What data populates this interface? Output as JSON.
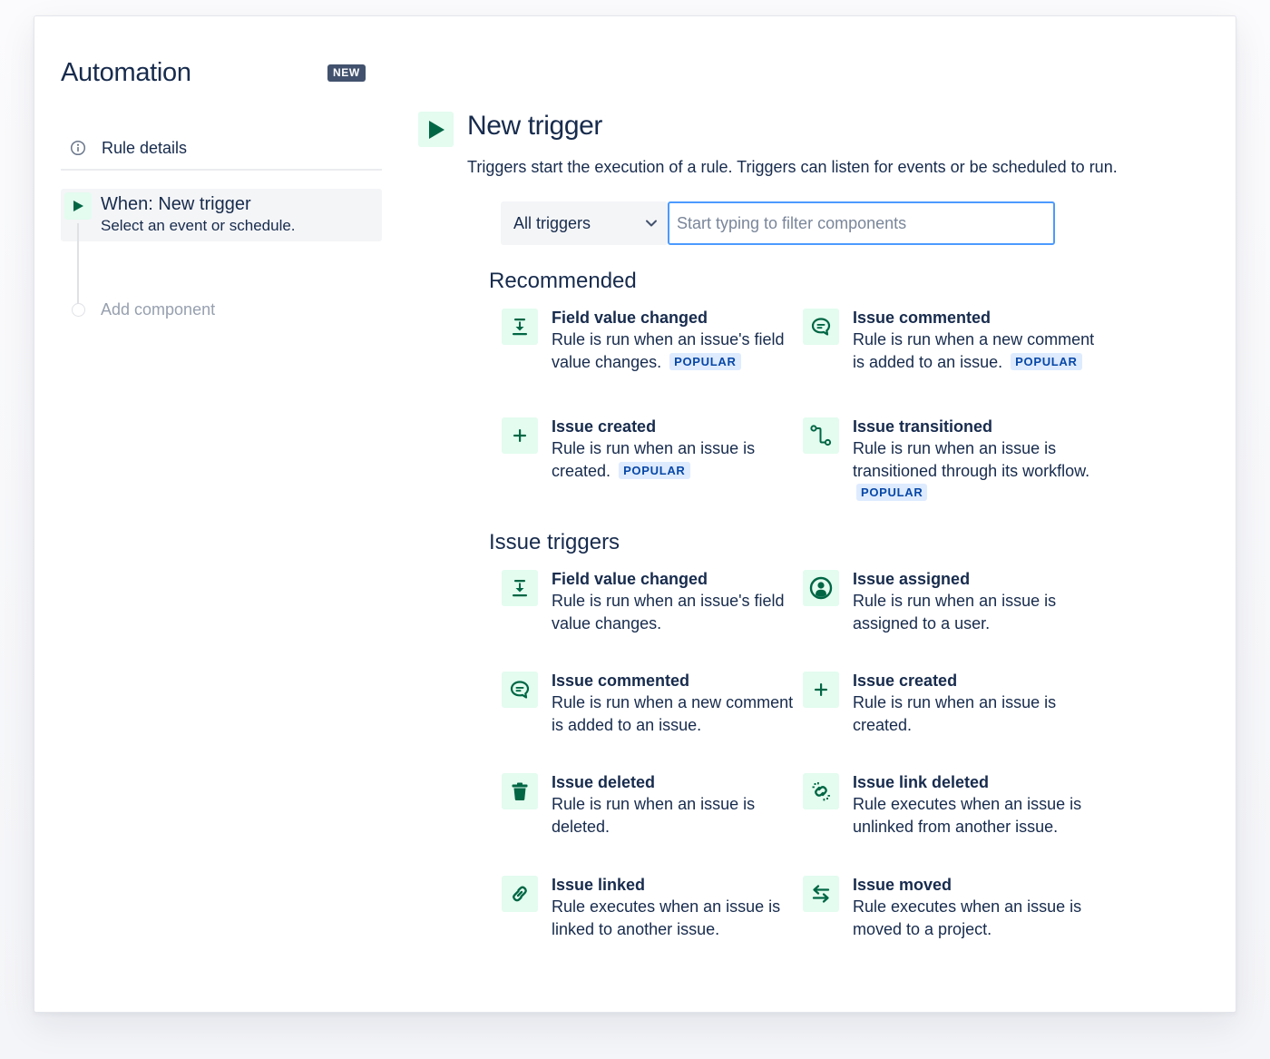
{
  "sidebar": {
    "app_title": "Automation",
    "new_badge": "NEW",
    "rule_details_label": "Rule details",
    "trigger_step": {
      "title": "When: New trigger",
      "subtitle": "Select an event or schedule."
    },
    "add_component_label": "Add component"
  },
  "main": {
    "title": "New trigger",
    "description": "Triggers start the execution of a rule. Triggers can listen for events or be scheduled to run.",
    "filter": {
      "select_value": "All triggers",
      "input_value": "",
      "input_placeholder": "Start typing to filter components"
    },
    "popular_label": "POPULAR",
    "sections": [
      {
        "title": "Recommended",
        "items": [
          {
            "name": "Field value changed",
            "description": "Rule is run when an issue's field value changes.",
            "icon": "field-value-changed-icon",
            "popular": true
          },
          {
            "name": "Issue commented",
            "description": "Rule is run when a new comment is added to an issue.",
            "icon": "comment-icon",
            "popular": true
          },
          {
            "name": "Issue created",
            "description": "Rule is run when an issue is created.",
            "icon": "plus-icon",
            "popular": true
          },
          {
            "name": "Issue transitioned",
            "description": "Rule is run when an issue is transitioned through its workflow.",
            "icon": "transition-icon",
            "popular": true
          }
        ]
      },
      {
        "title": "Issue triggers",
        "items": [
          {
            "name": "Field value changed",
            "description": "Rule is run when an issue's field value changes.",
            "icon": "field-value-changed-icon",
            "popular": false
          },
          {
            "name": "Issue assigned",
            "description": "Rule is run when an issue is assigned to a user.",
            "icon": "user-avatar-icon",
            "popular": false
          },
          {
            "name": "Issue commented",
            "description": "Rule is run when a new comment is added to an issue.",
            "icon": "comment-icon",
            "popular": false
          },
          {
            "name": "Issue created",
            "description": "Rule is run when an issue is created.",
            "icon": "plus-icon",
            "popular": false
          },
          {
            "name": "Issue deleted",
            "description": "Rule is run when an issue is deleted.",
            "icon": "trash-icon",
            "popular": false
          },
          {
            "name": "Issue link deleted",
            "description": "Rule executes when an issue is unlinked from another issue.",
            "icon": "unlink-icon",
            "popular": false
          },
          {
            "name": "Issue linked",
            "description": "Rule executes when an issue is linked to another issue.",
            "icon": "link-icon",
            "popular": false
          },
          {
            "name": "Issue moved",
            "description": "Rule executes when an issue is moved to a project.",
            "icon": "move-arrows-icon",
            "popular": false
          }
        ]
      }
    ]
  },
  "colors": {
    "accent_green": "#006644",
    "icon_bg": "#e3fcef",
    "popular_bg": "#deebff",
    "popular_text": "#0747a6",
    "input_focus": "#4c9aff",
    "badge_bg": "#42526e"
  }
}
